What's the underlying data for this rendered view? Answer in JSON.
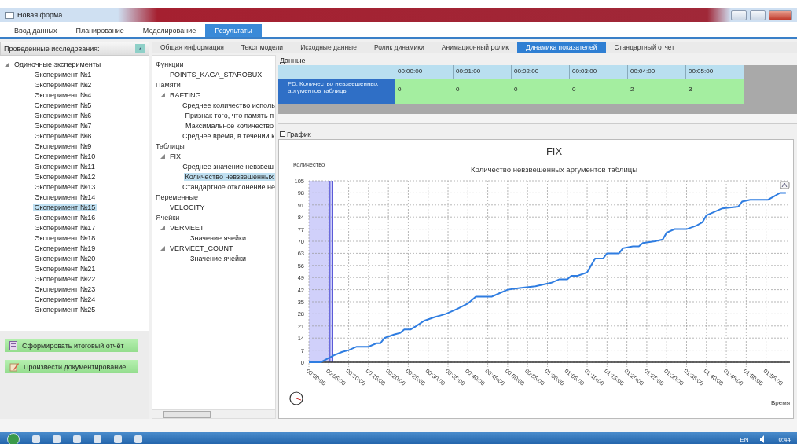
{
  "window": {
    "title": "Новая форма"
  },
  "main_tabs": [
    {
      "label": "Ввод данных",
      "selected": false
    },
    {
      "label": "Планирование",
      "selected": false
    },
    {
      "label": "Моделирование",
      "selected": false
    },
    {
      "label": "Результаты",
      "selected": true
    }
  ],
  "left_panel": {
    "title": "Проведенные исследования:",
    "collapse": "‹",
    "tree": [
      {
        "label": "Одиночные эксперименты",
        "expanded": true,
        "selected": false,
        "children": [
          {
            "label": "Эксперимент №1",
            "selected": false
          },
          {
            "label": "Эксперимент №2",
            "selected": false
          },
          {
            "label": "Эксперимент №4",
            "selected": false
          },
          {
            "label": "Эксперимент №5",
            "selected": false
          },
          {
            "label": "Эксперимент №6",
            "selected": false
          },
          {
            "label": "Эксперимент №7",
            "selected": false
          },
          {
            "label": "Эксперимент №8",
            "selected": false
          },
          {
            "label": "Эксперимент №9",
            "selected": false
          },
          {
            "label": "Эксперимент №10",
            "selected": false
          },
          {
            "label": "Эксперимент №11",
            "selected": false
          },
          {
            "label": "Эксперимент №12",
            "selected": false
          },
          {
            "label": "Эксперимент №13",
            "selected": false
          },
          {
            "label": "Эксперимент №14",
            "selected": false
          },
          {
            "label": "Эксперимент №15",
            "selected": true
          },
          {
            "label": "Эксперимент №16",
            "selected": false
          },
          {
            "label": "Эксперимент №17",
            "selected": false
          },
          {
            "label": "Эксперимент №18",
            "selected": false
          },
          {
            "label": "Эксперимент №19",
            "selected": false
          },
          {
            "label": "Эксперимент №20",
            "selected": false
          },
          {
            "label": "Эксперимент №21",
            "selected": false
          },
          {
            "label": "Эксперимент №22",
            "selected": false
          },
          {
            "label": "Эксперимент №23",
            "selected": false
          },
          {
            "label": "Эксперимент №24",
            "selected": false
          },
          {
            "label": "Эксперимент №25",
            "selected": false
          }
        ]
      }
    ],
    "buttons": [
      {
        "label": "Сформировать итоговый отчёт",
        "kind": "report"
      },
      {
        "label": "Произвести документирование",
        "kind": "document"
      }
    ]
  },
  "sub_tabs": [
    {
      "label": "Общая информация",
      "selected": false
    },
    {
      "label": "Текст модели",
      "selected": false
    },
    {
      "label": "Исходные данные",
      "selected": false
    },
    {
      "label": "Ролик динамики",
      "selected": false
    },
    {
      "label": "Анимационный ролик",
      "selected": false
    },
    {
      "label": "Динамика показателей",
      "selected": true
    },
    {
      "label": "Стандартный отчет",
      "selected": false
    }
  ],
  "object_tree": {
    "sections": [
      {
        "title": "Функции",
        "items": [
          {
            "label": "POINTS_KAGA_STAROBUX",
            "selected": false
          }
        ]
      },
      {
        "title": "Памяти",
        "items": [
          {
            "label": "RAFTING",
            "expanded": true,
            "selected": false,
            "children": [
              {
                "label": "Среднее количество исполь",
                "selected": false
              },
              {
                "label": "Признак того, что память п",
                "selected": false
              },
              {
                "label": "Максимальное количество",
                "selected": false
              },
              {
                "label": "Среднее время, в течении к",
                "selected": false
              }
            ]
          }
        ]
      },
      {
        "title": "Таблицы",
        "items": [
          {
            "label": "FIX",
            "expanded": true,
            "selected": false,
            "children": [
              {
                "label": "Среднее значение невзвеш",
                "selected": false
              },
              {
                "label": "Количество невзвешенных",
                "selected": true
              },
              {
                "label": "Стандартное отклонение не",
                "selected": false
              }
            ]
          }
        ]
      },
      {
        "title": "Переменные",
        "items": [
          {
            "label": "VELOCITY",
            "selected": false
          }
        ]
      },
      {
        "title": "Ячейки",
        "items": [
          {
            "label": "VERMEET",
            "expanded": true,
            "selected": false,
            "children": [
              {
                "label": "Значение ячейки",
                "selected": false
              }
            ]
          },
          {
            "label": "VERMEET_COUNT",
            "expanded": true,
            "selected": false,
            "children": [
              {
                "label": "Значение ячейки",
                "selected": false
              }
            ]
          }
        ]
      }
    ]
  },
  "data_table": {
    "title": "Данные",
    "columns": [
      "00:00:00",
      "00:01:00",
      "00:02:00",
      "00:03:00",
      "00:04:00",
      "00:05:00"
    ],
    "rows": [
      {
        "name": "FD: Количество невзвешенных аргументов таблицы",
        "selected": true,
        "values": [
          "0",
          "0",
          "0",
          "0",
          "2",
          "3"
        ]
      }
    ]
  },
  "chart_panel": {
    "title": "График",
    "chart_data": {
      "type": "line",
      "title": "FIX",
      "subtitle": "Количество невзвешенных аргументов таблицы",
      "xlabel": "Время",
      "ylabel": "Количество",
      "x": [
        0,
        3,
        6.3,
        8.4,
        10,
        12,
        15,
        17,
        18,
        19,
        21.4,
        23,
        24,
        25.6,
        27,
        29,
        31.5,
        33,
        34.5,
        37.4,
        40,
        42,
        46,
        48,
        50,
        53,
        57,
        59,
        61,
        63,
        65,
        66,
        67.6,
        70,
        72,
        74,
        75,
        78,
        79,
        81.5,
        83,
        84,
        87,
        89,
        90,
        92,
        95,
        97.5,
        99,
        100,
        102,
        104,
        108,
        109,
        111,
        115.5,
        117,
        118.5,
        120
      ],
      "series": [
        {
          "color": "#2f7de1",
          "values": [
            0,
            0,
            4,
            6,
            7,
            9,
            9,
            11,
            11,
            14,
            16,
            17,
            19,
            19,
            21,
            24,
            26,
            27,
            28,
            31,
            34,
            38,
            38,
            40,
            42,
            43,
            44,
            45,
            46,
            48,
            48,
            50,
            50,
            52,
            60,
            60,
            63,
            63,
            66,
            67,
            67,
            69,
            70,
            71,
            75,
            77,
            77,
            79,
            81,
            85,
            87,
            89,
            90,
            93,
            94,
            94,
            96,
            98,
            98
          ]
        }
      ],
      "xlim": [
        0,
        121
      ],
      "ylim": [
        0,
        105
      ],
      "grid": true,
      "bands": [
        {
          "axis": "x",
          "from": 0,
          "to": 6,
          "color": "#d0d0fa"
        }
      ],
      "ref_lines": [
        {
          "axis": "x",
          "value": 5.3,
          "color": "#4040d0"
        },
        {
          "axis": "x",
          "value": 6,
          "color": "#4040d0"
        }
      ],
      "xticks": [
        {
          "value": 0,
          "label": "00:00:00"
        },
        {
          "value": 5,
          "label": "00:05:00"
        },
        {
          "value": 10,
          "label": "00:10:00"
        },
        {
          "value": 15,
          "label": "00:15:00"
        },
        {
          "value": 20,
          "label": "00:20:00"
        },
        {
          "value": 25,
          "label": "00:25:00"
        },
        {
          "value": 30,
          "label": "00:30:00"
        },
        {
          "value": 35,
          "label": "00:35:00"
        },
        {
          "value": 40,
          "label": "00:40:00"
        },
        {
          "value": 45,
          "label": "00:45:00"
        },
        {
          "value": 50,
          "label": "00:50:00"
        },
        {
          "value": 55,
          "label": "00:55:00"
        },
        {
          "value": 60,
          "label": "01:00:00"
        },
        {
          "value": 65,
          "label": "01:05:00"
        },
        {
          "value": 70,
          "label": "01:10:00"
        },
        {
          "value": 75,
          "label": "01:15:00"
        },
        {
          "value": 80,
          "label": "01:20:00"
        },
        {
          "value": 85,
          "label": "01:25:00"
        },
        {
          "value": 90,
          "label": "01:30:00"
        },
        {
          "value": 95,
          "label": "01:35:00"
        },
        {
          "value": 100,
          "label": "01:40:00"
        },
        {
          "value": 105,
          "label": "01:45:00"
        },
        {
          "value": 110,
          "label": "01:50:00"
        },
        {
          "value": 115,
          "label": "01:55:00"
        }
      ],
      "yticks": [
        0,
        7,
        14,
        21,
        28,
        35,
        42,
        49,
        56,
        63,
        70,
        77,
        84,
        91,
        98,
        105
      ]
    }
  },
  "taskbar": {
    "language": "EN",
    "clock": "0:44"
  }
}
